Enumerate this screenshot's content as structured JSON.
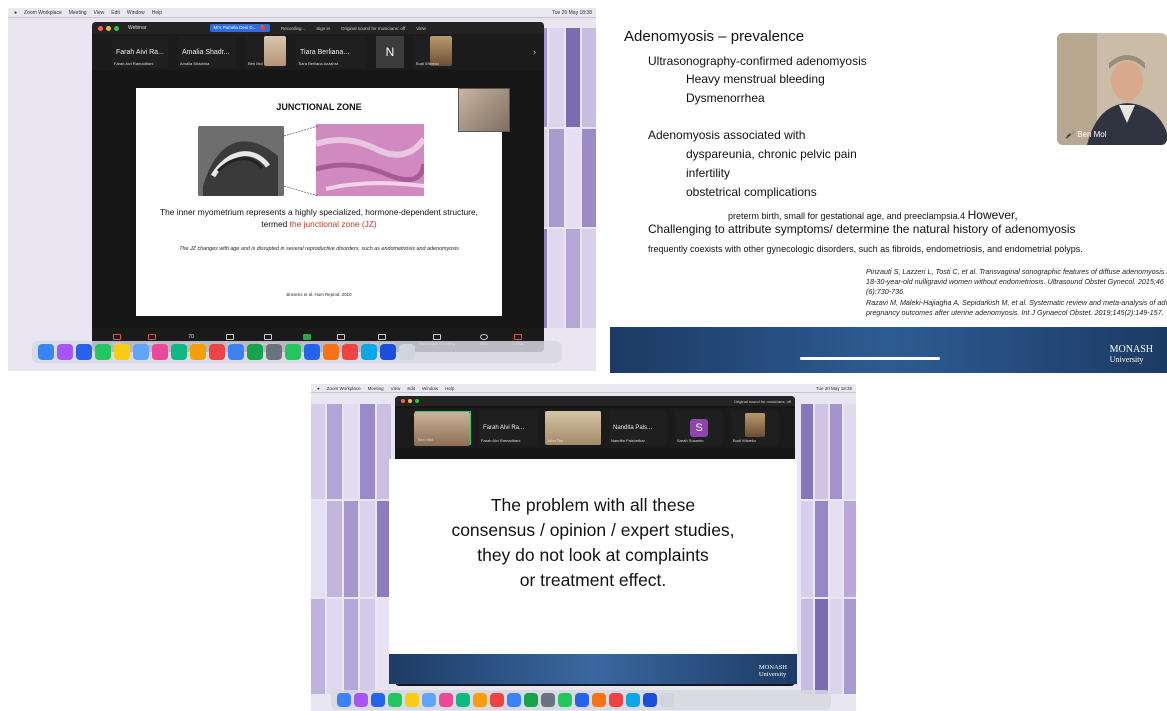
{
  "panel1": {
    "menubar": {
      "items": [
        "Zoom Workplace",
        "Meeting",
        "View",
        "Edit",
        "Window",
        "Help"
      ],
      "clock": "Tue 20 May 18:38"
    },
    "window_title": "Webinar",
    "share_chip": "Mi's Pamela Desi D... · 🔴",
    "recording": "Recording...",
    "signin": "Sign in",
    "original_sound": "Original sound for musicians: off",
    "view": "View",
    "participants": [
      {
        "name": "Farah Aivi Ra...",
        "caption": "Farah Alvi Ramadhani"
      },
      {
        "name": "Amalia Shadr...",
        "caption": "Amalia Shadrina"
      },
      {
        "name": "",
        "caption": "Ben Mol"
      },
      {
        "name": "Tiara Berliana...",
        "caption": "Tiara Berliana Azzahra"
      },
      {
        "name": "N",
        "caption": "Nurul Hakimul"
      },
      {
        "name": "",
        "caption": "Budi Wiweko"
      }
    ],
    "slide": {
      "title": "JUNCTIONAL ZONE",
      "body_before": "The inner myometrium represents a highly specialized, hormone-dependent structure, termed ",
      "body_red": "the junctional zone (JZ)",
      "note": "The JZ changes with age and is disrupted in several reproductive disorders, such as endometriosis and adenomyosis",
      "reference": "Brosens et al.  Hum Reprod. 2010"
    },
    "toolbar": [
      "Audio",
      "Video",
      "Participants",
      "Chat",
      "Raise hand",
      "Share",
      "Q&A",
      "Show captions",
      "Pause/stop recording",
      "More",
      "Leave"
    ],
    "participant_count": "70"
  },
  "panel2": {
    "title": "Adenomyosis – prevalence",
    "line1": "Ultrasonography-confirmed adenomyosis",
    "sub1": [
      "Heavy menstrual bleeding",
      "Dysmenorrhea"
    ],
    "line2": "Adenomyosis associated with",
    "sub2": [
      "dyspareunia, chronic pelvic pain",
      "infertility",
      "obstetrical complications"
    ],
    "sub3": "preterm birth, small for gestational age, and preeclampsia.4",
    "however": "However,",
    "challenge": "Challenging to attribute symptoms/ determine the natural history of adenomyosis",
    "coexist": "frequently coexists with other gynecologic disorders, such as fibroids, endometriosis, and endometrial polyps.",
    "refs": [
      "Pinzauti S, Lazzeri L, Tosti C, et al. Transvaginal sonographic features of diffuse adenomyosis in",
      "18-30-year-old nulligravid women without endometriosis. Ultrasound Obstet Gynecol. 2015;46",
      "(6):730-736.",
      "Razavi M, Maleki-Hajiagha A, Sepidarkish M, et al. Systematic review and meta-analysis of adverse",
      "pregnancy outcomes after uterine adenomyosis. Int J Gynaecol Obstet. 2019;145(2):149-157."
    ],
    "video_name": "Ben Mol",
    "logo": {
      "top": "MONASH",
      "bottom": "University"
    }
  },
  "panel3": {
    "menubar": {
      "items": [
        "Zoom Workplace",
        "Meeting",
        "View",
        "Edit",
        "Window",
        "Help"
      ],
      "clock": "Tue 20 May 18:38"
    },
    "original_sound": "Original sound for musicians: off",
    "participants": [
      {
        "name": "",
        "caption": "Ben Mol"
      },
      {
        "name": "Farah Alvi Ra...",
        "caption": "Farah Alvi Ramadhani"
      },
      {
        "name": "",
        "caption": "John Tan"
      },
      {
        "name": "Nandita Pals...",
        "caption": "Nandita Palshetkar"
      },
      {
        "name": "S",
        "caption": "Sarah Susanto"
      },
      {
        "name": "",
        "caption": "Budi Wiweko"
      }
    ],
    "quote": [
      "The problem with all these",
      "consensus / opinion / expert studies,",
      "they do not look at complaints",
      "or treatment effect."
    ],
    "logo": {
      "top": "MONASH",
      "bottom": "University"
    }
  }
}
